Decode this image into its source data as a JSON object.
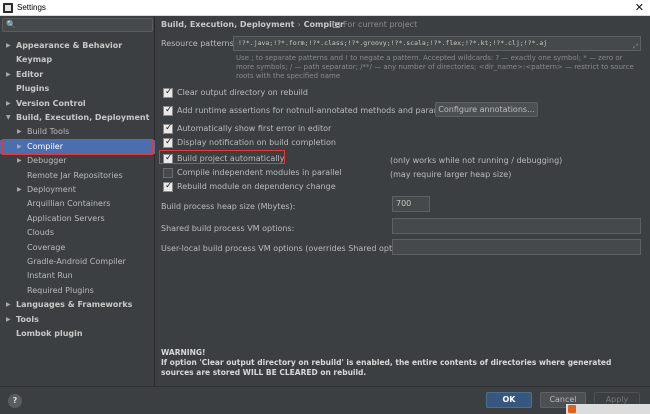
{
  "window": {
    "title": "Settings",
    "close_glyph": "✕"
  },
  "search": {
    "icon": "search-icon",
    "glyph": "🔍"
  },
  "tree": [
    {
      "label": "Appearance & Behavior",
      "bold": true,
      "arrow": "▶"
    },
    {
      "label": "Keymap",
      "bold": true,
      "arrow": ""
    },
    {
      "label": "Editor",
      "bold": true,
      "arrow": "▶"
    },
    {
      "label": "Plugins",
      "bold": true,
      "arrow": ""
    },
    {
      "label": "Version Control",
      "bold": true,
      "arrow": "▶"
    },
    {
      "label": "Build, Execution, Deployment",
      "bold": true,
      "arrow": "▼"
    },
    {
      "label": "Build Tools",
      "bold": false,
      "arrow": "▶"
    },
    {
      "label": "Compiler",
      "bold": false,
      "arrow": "▶",
      "selected": true
    },
    {
      "label": "Debugger",
      "bold": false,
      "arrow": "▶"
    },
    {
      "label": "Remote Jar Repositories",
      "bold": false,
      "arrow": ""
    },
    {
      "label": "Deployment",
      "bold": false,
      "arrow": "▶"
    },
    {
      "label": "Arquillian Containers",
      "bold": false,
      "arrow": ""
    },
    {
      "label": "Application Servers",
      "bold": false,
      "arrow": ""
    },
    {
      "label": "Clouds",
      "bold": false,
      "arrow": ""
    },
    {
      "label": "Coverage",
      "bold": false,
      "arrow": ""
    },
    {
      "label": "Gradle-Android Compiler",
      "bold": false,
      "arrow": ""
    },
    {
      "label": "Instant Run",
      "bold": false,
      "arrow": ""
    },
    {
      "label": "Required Plugins",
      "bold": false,
      "arrow": ""
    },
    {
      "label": "Languages & Frameworks",
      "bold": true,
      "arrow": "▶"
    },
    {
      "label": "Tools",
      "bold": true,
      "arrow": "▶"
    },
    {
      "label": "Lombok plugin",
      "bold": true,
      "arrow": ""
    }
  ],
  "breadcrumb": {
    "parent": "Build, Execution, Deployment",
    "separator": "›",
    "current": "Compiler",
    "scope": "For current project"
  },
  "resource": {
    "label": "Resource patterns:",
    "value": "!?*.java;!?*.form;!?*.class;!?*.groovy;!?*.scala;!?*.flex;!?*.kt;!?*.clj;!?*.aj",
    "expand_glyph": "⤢",
    "hint": "Use ; to separate patterns and ! to negate a pattern. Accepted wildcards: ? — exactly one symbol; * — zero or more symbols; / — path separator; /**/ — any number of directories; <dir_name>:<pattern> — restrict to source roots with the specified name"
  },
  "options": [
    {
      "label": "Clear output directory on rebuild",
      "checked": true
    },
    {
      "label": "Add runtime assertions for notnull-annotated methods and parameters",
      "checked": true
    },
    {
      "label": "Automatically show first error in editor",
      "checked": true
    },
    {
      "label": "Display notification on build completion",
      "checked": true
    },
    {
      "label": "Build project automatically",
      "checked": true
    },
    {
      "label": "Compile independent modules in parallel",
      "checked": false
    },
    {
      "label": "Rebuild module on dependency change",
      "checked": true
    }
  ],
  "notes": {
    "build_auto": "(only works while not running / debugging)",
    "parallel": "(may require larger heap size)"
  },
  "configure_button": "Configure annotations...",
  "heap": {
    "label": "Build process heap size (Mbytes):",
    "value": "700"
  },
  "shared_vm": {
    "label": "Shared build process VM options:",
    "value": ""
  },
  "user_vm": {
    "label": "User-local build process VM options (overrides Shared options):",
    "value": ""
  },
  "warning": {
    "title": "WARNING!",
    "text": "If option 'Clear output directory on rebuild' is enabled, the entire contents of directories where generated sources are stored WILL BE CLEARED on rebuild."
  },
  "footer": {
    "help": "?",
    "ok": "OK",
    "cancel": "Cancel",
    "apply": "Apply"
  }
}
